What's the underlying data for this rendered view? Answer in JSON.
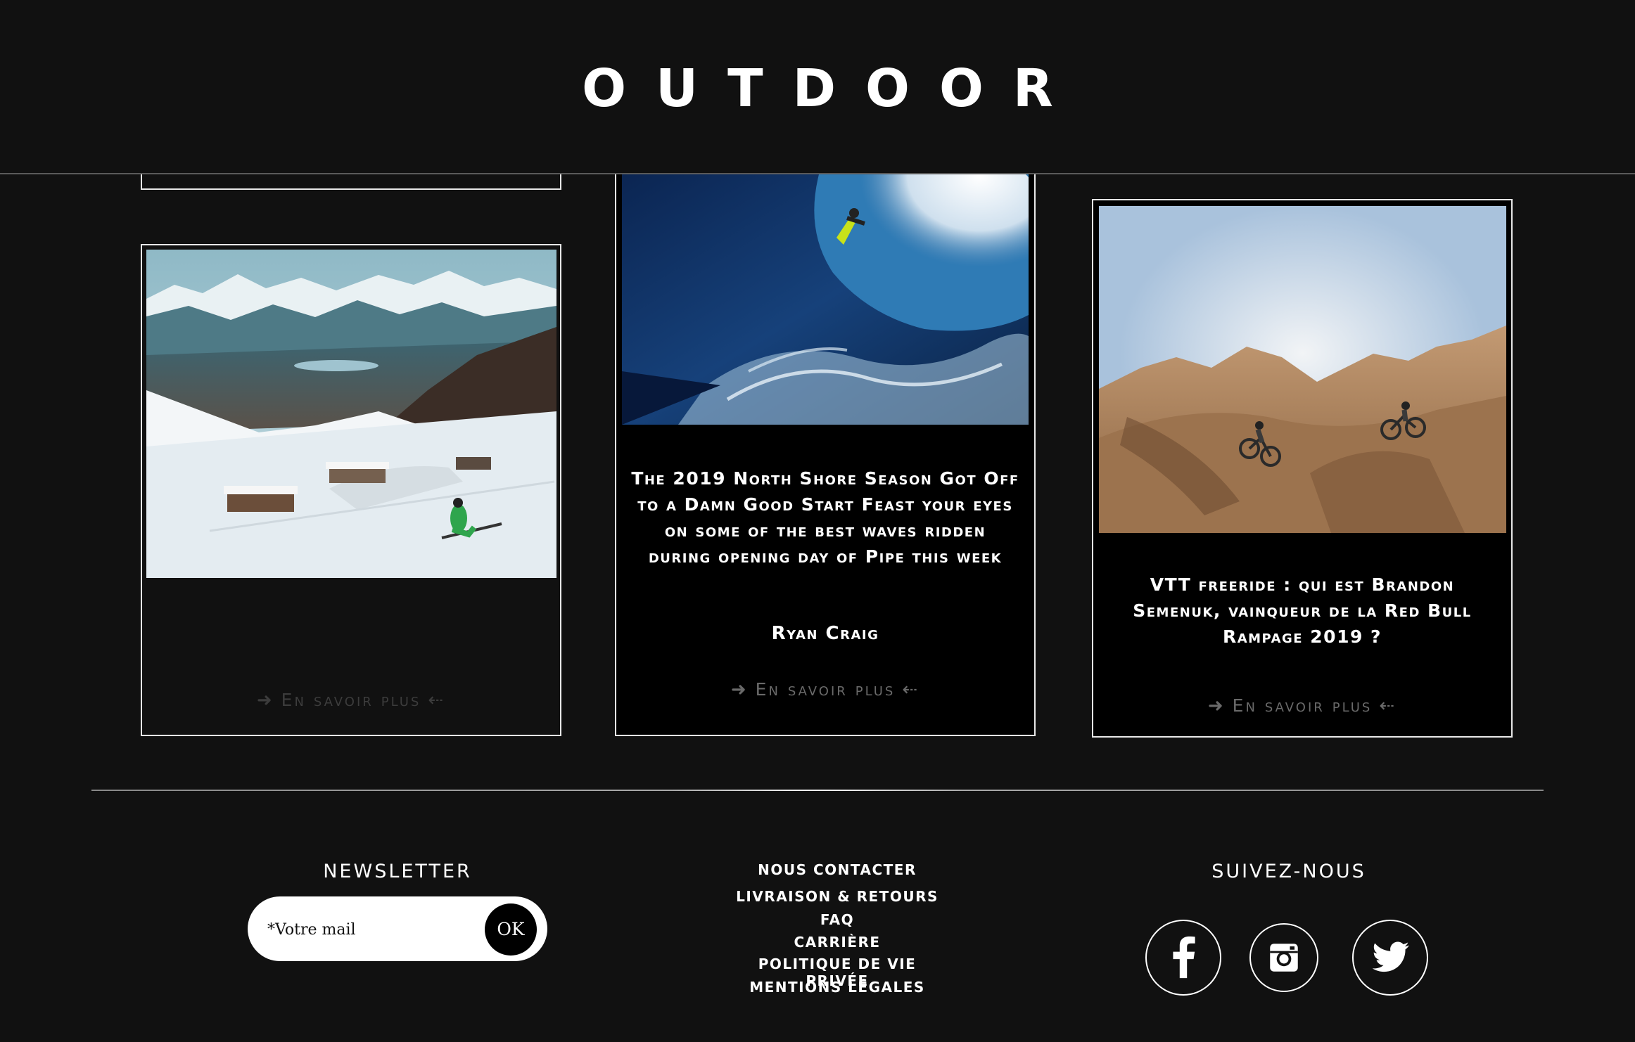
{
  "header": {
    "logo": "OUTDOOR"
  },
  "articles": [
    {
      "title": "",
      "author": "",
      "more_label": "En savoir plus",
      "image": "ski-slope-mountain-image"
    },
    {
      "title": "The 2019 North Shore Season Got Off to a Damn Good Start Feast your eyes on some of the best waves ridden during opening day of Pipe this week",
      "author": "Ryan Craig",
      "more_label": "En savoir plus",
      "image": "surfer-wave-image"
    },
    {
      "title": "VTT freeride : qui est Brandon Semenuk, vainqueur de la Red Bull Rampage 2019 ?",
      "author": "",
      "more_label": "En savoir plus",
      "image": "mountain-bike-desert-image"
    }
  ],
  "footer": {
    "newsletter": {
      "heading": "NEWSLETTER",
      "placeholder": "*Votre mail",
      "submit": "OK"
    },
    "links": [
      "NOUS CONTACTER",
      "LIVRAISON & RETOURS",
      "FAQ",
      "CARRIÈRE",
      "POLITIQUE DE VIE PRIVÉE",
      "MENTIONS LÉGALES"
    ],
    "social": {
      "heading": "SUIVEZ-NOUS",
      "icons": [
        "facebook-icon",
        "instagram-icon",
        "twitter-icon"
      ]
    }
  },
  "colors": {
    "background": "#111111",
    "text": "#ffffff",
    "card_bg": "#000000",
    "muted": "#6a6a6a"
  }
}
